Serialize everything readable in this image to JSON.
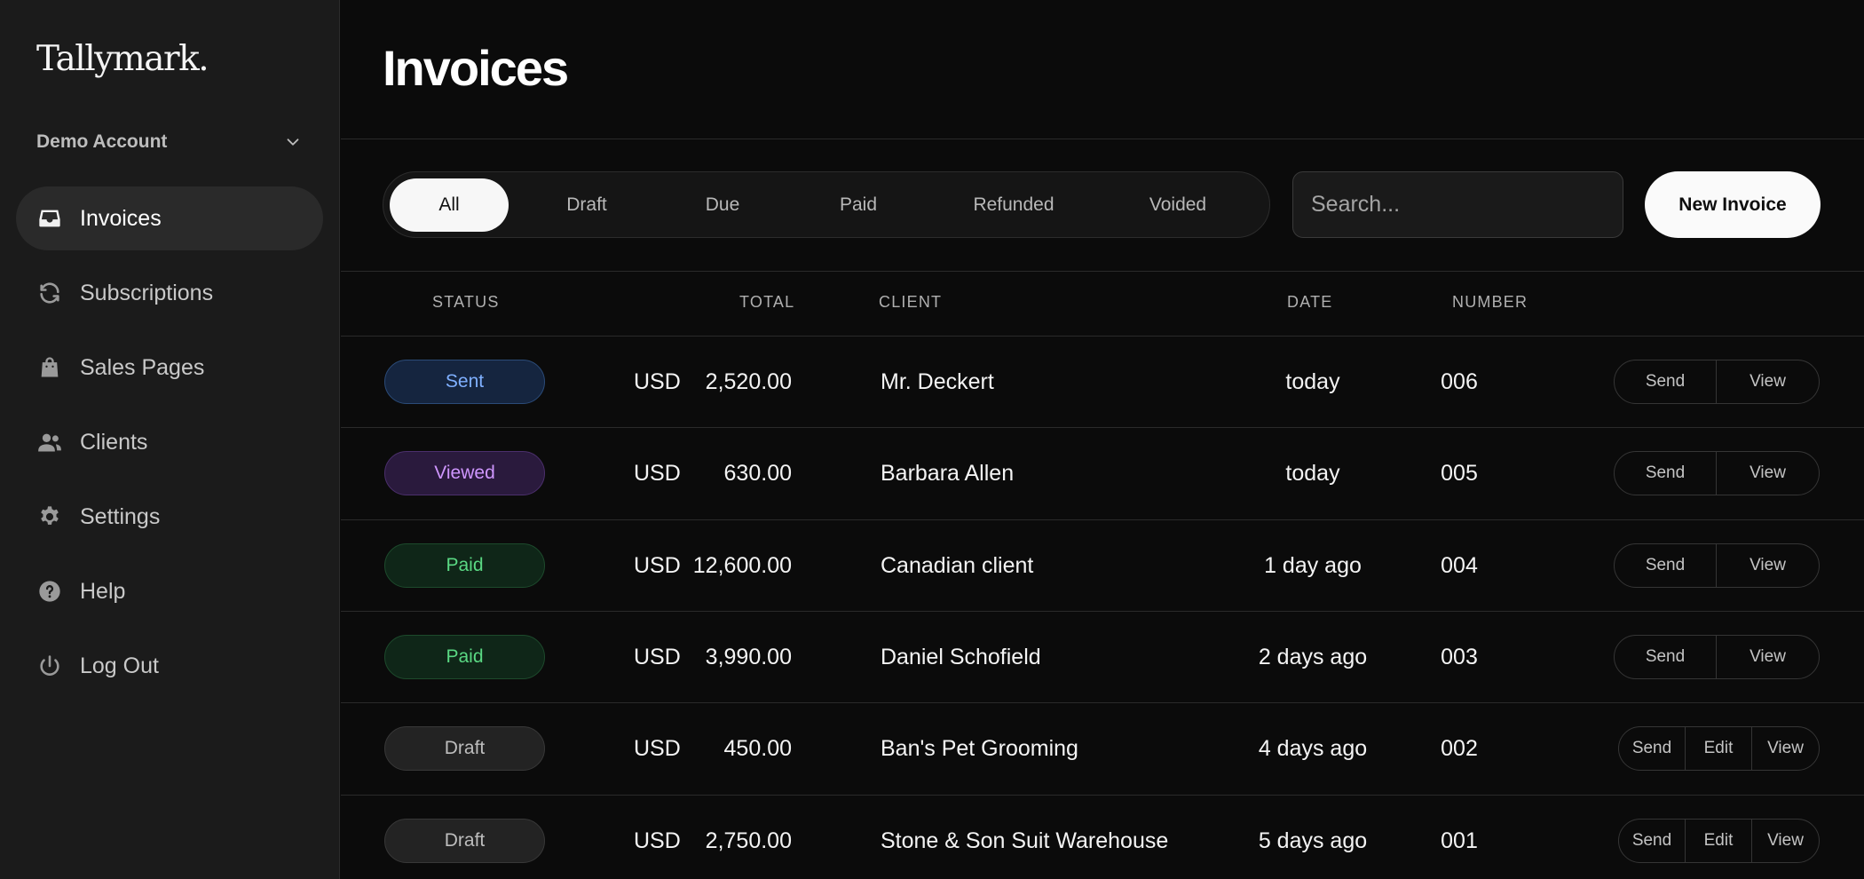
{
  "brand": {
    "logo": "Tallymark."
  },
  "account": {
    "name": "Demo Account"
  },
  "nav": [
    {
      "label": "Invoices",
      "icon": "inbox-icon",
      "active": true
    },
    {
      "label": "Subscriptions",
      "icon": "refresh-icon",
      "active": false
    },
    {
      "label": "Sales Pages",
      "icon": "shopping-bag-icon",
      "active": false
    },
    {
      "label": "Clients",
      "icon": "users-icon",
      "active": false
    },
    {
      "label": "Settings",
      "icon": "gear-icon",
      "active": false
    },
    {
      "label": "Help",
      "icon": "help-icon",
      "active": false
    },
    {
      "label": "Log Out",
      "icon": "power-icon",
      "active": false
    }
  ],
  "page": {
    "title": "Invoices"
  },
  "filters": {
    "tabs": [
      "All",
      "Draft",
      "Due",
      "Paid",
      "Refunded",
      "Voided"
    ],
    "active": "All"
  },
  "search": {
    "placeholder": "Search..."
  },
  "toolbar": {
    "new_invoice": "New Invoice"
  },
  "table": {
    "headers": {
      "status": "STATUS",
      "total": "TOTAL",
      "client": "CLIENT",
      "date": "DATE",
      "number": "NUMBER"
    },
    "rows": [
      {
        "status": "Sent",
        "status_kind": "sent",
        "currency": "USD",
        "amount": "2,520.00",
        "client": "Mr. Deckert",
        "date": "today",
        "number": "006",
        "actions": [
          "Send",
          "View"
        ]
      },
      {
        "status": "Viewed",
        "status_kind": "viewed",
        "currency": "USD",
        "amount": "630.00",
        "client": "Barbara Allen",
        "date": "today",
        "number": "005",
        "actions": [
          "Send",
          "View"
        ]
      },
      {
        "status": "Paid",
        "status_kind": "paid",
        "currency": "USD",
        "amount": "12,600.00",
        "client": "Canadian client",
        "date": "1 day ago",
        "number": "004",
        "actions": [
          "Send",
          "View"
        ]
      },
      {
        "status": "Paid",
        "status_kind": "paid",
        "currency": "USD",
        "amount": "3,990.00",
        "client": "Daniel Schofield",
        "date": "2 days ago",
        "number": "003",
        "actions": [
          "Send",
          "View"
        ]
      },
      {
        "status": "Draft",
        "status_kind": "draft",
        "currency": "USD",
        "amount": "450.00",
        "client": "Ban's Pet Grooming",
        "date": "4 days ago",
        "number": "002",
        "actions": [
          "Send",
          "Edit",
          "View"
        ]
      },
      {
        "status": "Draft",
        "status_kind": "draft",
        "currency": "USD",
        "amount": "2,750.00",
        "client": "Stone & Son Suit Warehouse",
        "date": "5 days ago",
        "number": "001",
        "actions": [
          "Send",
          "Edit",
          "View"
        ]
      }
    ]
  },
  "colors": {
    "background": "#0b0b0b",
    "sidebar": "#1b1b1b",
    "sent": "#7fb0ff",
    "viewed": "#cf96ff",
    "paid": "#5ad883",
    "draft": "#bdbdbd"
  }
}
